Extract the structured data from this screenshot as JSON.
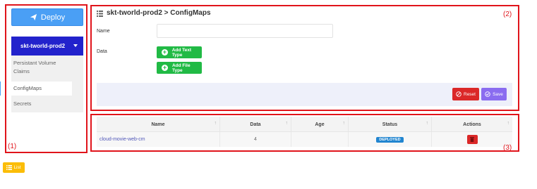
{
  "sidebar": {
    "deploy_label": "Deploy",
    "cluster_label": "skt-tworld-prod2",
    "items": [
      {
        "label": "Persistant Volume Claims"
      },
      {
        "label": "ConfigMaps"
      },
      {
        "label": "Secrets"
      }
    ]
  },
  "header": {
    "title": "skt-tworld-prod2 > ConfigMaps"
  },
  "form": {
    "name_label": "Name",
    "name_value": "",
    "data_label": "Data",
    "add_text_type_label": "Add Text Type",
    "add_file_type_label": "Add File Type",
    "reset_label": "Reset",
    "save_label": "Save"
  },
  "table": {
    "columns": [
      "Name",
      "Data",
      "Age",
      "Status",
      "Actions"
    ],
    "rows": [
      {
        "name": "cloud-movie-web-cm",
        "data": "4",
        "age": "",
        "status": "DEPLOYED"
      }
    ]
  },
  "footer": {
    "list_label": "List"
  },
  "annotations": [
    "(1)",
    "(2)",
    "(3)"
  ],
  "colors": {
    "annotation_red": "#e0141b",
    "deploy_blue": "#4a9ff5",
    "cluster_blue": "#2222cc",
    "green": "#21ba45",
    "reset_red": "#db2828",
    "save_purple": "#8a6cf0",
    "status_blue": "#2185d0",
    "list_yellow": "#fbbd08"
  },
  "icons": {
    "deploy": "paper-plane-icon",
    "header": "list-icon",
    "add": "plus-circle-icon",
    "reset": "ban-icon",
    "save": "check-circle-icon",
    "delete": "trash-icon",
    "list": "list-icon"
  }
}
